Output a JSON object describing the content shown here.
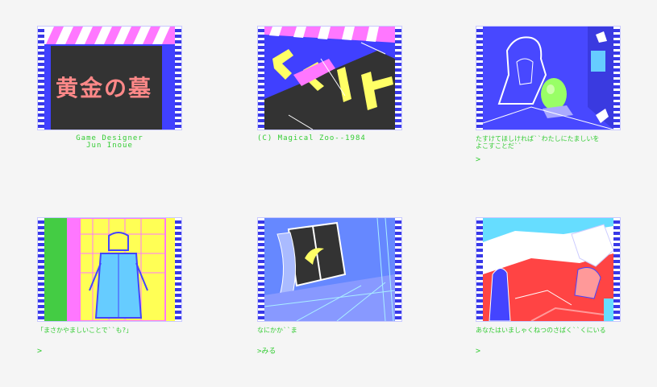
{
  "scenes": [
    {
      "caption": "Game Designer\nJun Inoue",
      "art_title": "黄金の墓"
    },
    {
      "caption": "(C) Magical Zoo--1984"
    },
    {
      "caption": "たすけてほしければ``わたしにたましいをよこすことだ``",
      "prompt": ">"
    },
    {
      "caption": "「まさかやましいことで``も?」",
      "prompt": ">"
    },
    {
      "caption": "なにかか``ま",
      "prompt": ">みる"
    },
    {
      "caption": "あなたはいましゃくねつのさばく``くにいる",
      "prompt": ">"
    }
  ]
}
